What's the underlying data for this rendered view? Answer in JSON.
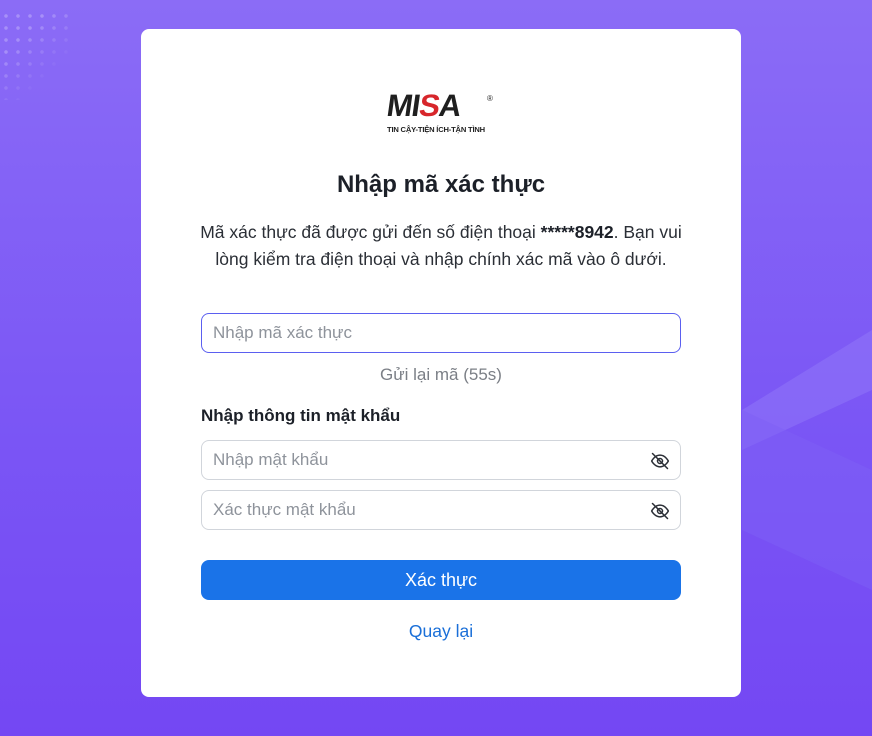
{
  "brand": {
    "logo_part1": "MI",
    "logo_part2": "S",
    "logo_part3": "A",
    "registered": "®",
    "tagline": "TIN CẬY-TIỆN ÍCH-TẬN TÌNH",
    "primary_color": "#1a73e8",
    "accent_red": "#d7262b"
  },
  "form": {
    "title": "Nhập mã xác thực",
    "description_prefix": "Mã xác thực đã được gửi đến số điện thoại ",
    "phone_masked": "*****8942",
    "description_suffix": ". Bạn vui lòng kiểm tra điện thoại và nhập chính xác mã vào ô dưới.",
    "code_input": {
      "placeholder": "Nhập mã xác thực",
      "value": ""
    },
    "resend_label": "Gửi lại mã (55s)",
    "password_section_title": "Nhập thông tin mật khẩu",
    "password_input": {
      "placeholder": "Nhập mật khẩu",
      "value": "",
      "icon": "eye-off-icon"
    },
    "confirm_password_input": {
      "placeholder": "Xác thực mật khẩu",
      "value": "",
      "icon": "eye-off-icon"
    },
    "submit_label": "Xác thực",
    "back_label": "Quay lại"
  }
}
